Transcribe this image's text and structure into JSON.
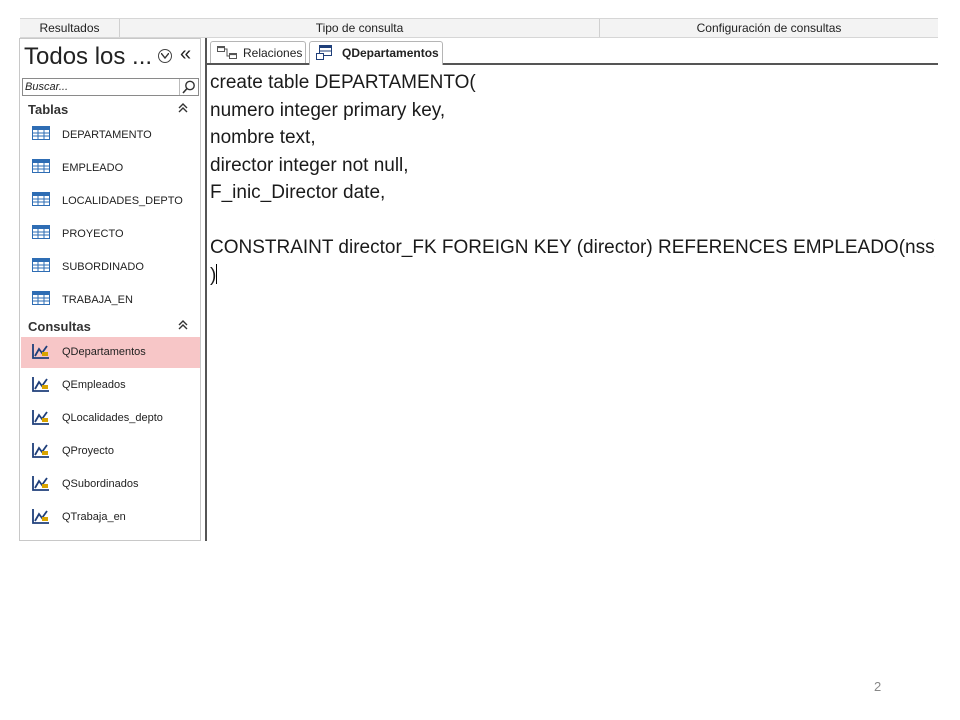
{
  "ribbon": {
    "groups": [
      "Resultados",
      "Tipo de consulta",
      "Configuración de consultas"
    ]
  },
  "nav": {
    "title": "Todos los ...",
    "dropdown_icon": "circle-chevron-down-icon",
    "collapse_glyph": "«",
    "search_placeholder": "Buscar...",
    "sections": {
      "tables": {
        "label": "Tablas",
        "items": [
          "DEPARTAMENTO",
          "EMPLEADO",
          "LOCALIDADES_DEPTO",
          "PROYECTO",
          "SUBORDINADO",
          "TRABAJA_EN"
        ]
      },
      "queries": {
        "label": "Consultas",
        "selected": "QDepartamentos",
        "items": [
          "QDepartamentos",
          "QEmpleados",
          "QLocalidades_depto",
          "QProyecto",
          "QSubordinados",
          "QTrabaja_en"
        ]
      }
    }
  },
  "tabs": [
    {
      "label": "Relaciones",
      "icon": "relationships-icon",
      "active": false
    },
    {
      "label": "QDepartamentos",
      "icon": "query-icon",
      "active": true
    }
  ],
  "editor": {
    "lines": [
      "create table DEPARTAMENTO(",
      "numero integer primary key,",
      "nombre text,",
      "director integer not null,",
      "F_inic_Director date,",
      "",
      "CONSTRAINT director_FK FOREIGN KEY (director) REFERENCES EMPLEADO(nss)",
      ")"
    ]
  },
  "page_number": "2",
  "colors": {
    "selected_item": "#f7c6c7",
    "table_icon": "#2e6db4",
    "query_icon": "#1f3f7a"
  }
}
